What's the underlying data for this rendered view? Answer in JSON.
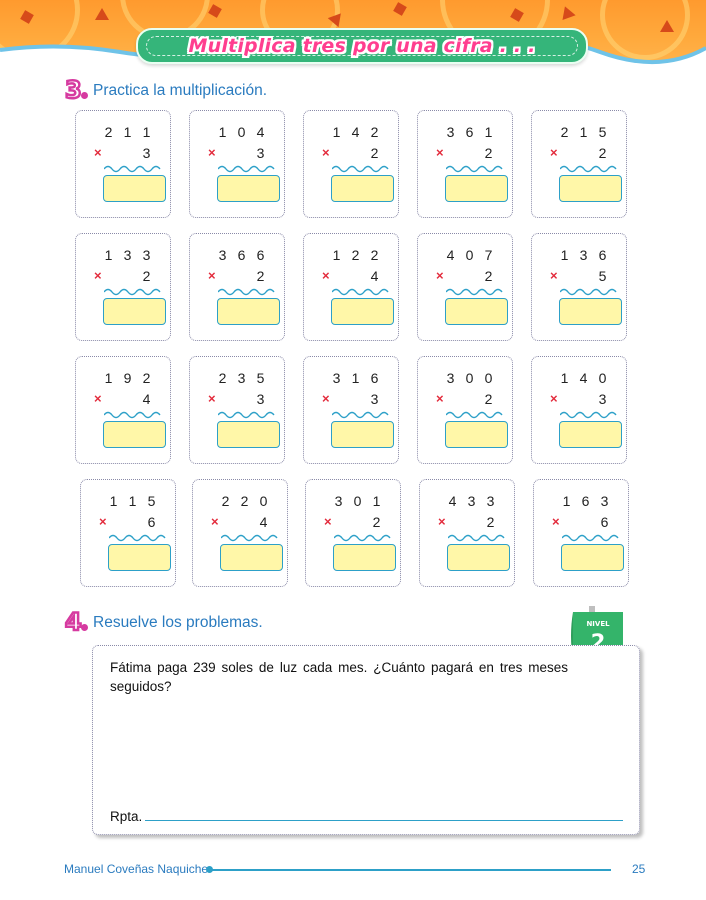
{
  "header": {
    "title": "Multiplica tres por una cifra . . ."
  },
  "section3": {
    "number": "3",
    "title": "Practica la multiplicación."
  },
  "exercises": [
    [
      {
        "top": [
          "2",
          "1",
          "1"
        ],
        "mult": "3"
      },
      {
        "top": [
          "1",
          "0",
          "4"
        ],
        "mult": "3"
      },
      {
        "top": [
          "1",
          "4",
          "2"
        ],
        "mult": "2"
      },
      {
        "top": [
          "3",
          "6",
          "1"
        ],
        "mult": "2"
      },
      {
        "top": [
          "2",
          "1",
          "5"
        ],
        "mult": "2"
      }
    ],
    [
      {
        "top": [
          "1",
          "3",
          "3"
        ],
        "mult": "2"
      },
      {
        "top": [
          "3",
          "6",
          "6"
        ],
        "mult": "2"
      },
      {
        "top": [
          "1",
          "2",
          "2"
        ],
        "mult": "4"
      },
      {
        "top": [
          "4",
          "0",
          "7"
        ],
        "mult": "2"
      },
      {
        "top": [
          "1",
          "3",
          "6"
        ],
        "mult": "5"
      }
    ],
    [
      {
        "top": [
          "1",
          "9",
          "2"
        ],
        "mult": "4"
      },
      {
        "top": [
          "2",
          "3",
          "5"
        ],
        "mult": "3"
      },
      {
        "top": [
          "3",
          "1",
          "6"
        ],
        "mult": "3"
      },
      {
        "top": [
          "3",
          "0",
          "0"
        ],
        "mult": "2"
      },
      {
        "top": [
          "1",
          "4",
          "0"
        ],
        "mult": "3"
      }
    ],
    [
      {
        "top": [
          "1",
          "1",
          "5"
        ],
        "mult": "6"
      },
      {
        "top": [
          "2",
          "2",
          "0"
        ],
        "mult": "4"
      },
      {
        "top": [
          "3",
          "0",
          "1"
        ],
        "mult": "2"
      },
      {
        "top": [
          "4",
          "3",
          "3"
        ],
        "mult": "2"
      },
      {
        "top": [
          "1",
          "6",
          "3"
        ],
        "mult": "6"
      }
    ]
  ],
  "times_symbol": "×",
  "section4": {
    "number": "4",
    "title": "Resuelve los problemas."
  },
  "nivel": {
    "label": "NIVEL",
    "value": "2"
  },
  "problem": {
    "text": "Fátima paga 239 soles de luz cada mes. ¿Cuánto pagará en tres meses seguidos?",
    "answer_label": "Rpta."
  },
  "footer": {
    "author": "Manuel Coveñas Naquiche",
    "page": "25"
  },
  "colors": {
    "accent_blue": "#2a7bbf",
    "heading_pink": "#d63aa0",
    "answer_fill": "#fff7a8",
    "banner_orange": "#ff9a2e",
    "pill_green": "#35b57a"
  }
}
